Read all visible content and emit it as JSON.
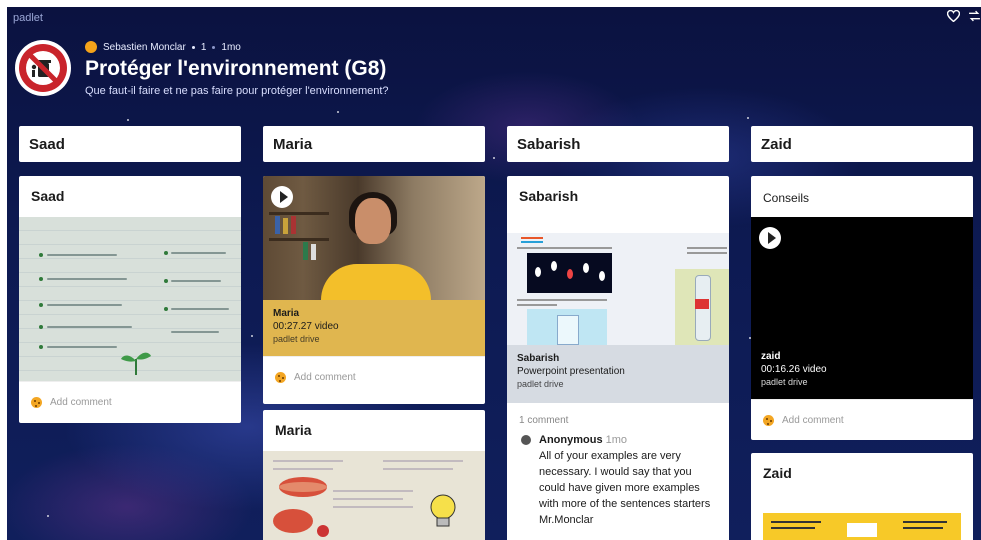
{
  "app": {
    "brand": "padlet"
  },
  "header": {
    "author": "Sebastien Monclar",
    "reactions": "1",
    "age": "1mo",
    "title": "Protéger l'environnement (G8)",
    "subtitle": "Que faut-il faire et ne pas faire pour protéger l'environnement?"
  },
  "icons": {
    "heart": "heart-icon",
    "remake": "remake-icon",
    "play": "play-icon",
    "cookie": "cookie-avatar-icon"
  },
  "colors": {
    "background": "#0d1a52",
    "author_dot": "#f5a31a",
    "video_bar": "#e0b64f",
    "attachment_bar": "#d6dbe2"
  },
  "columns": [
    {
      "name": "Saad",
      "cards": [
        {
          "title": "Saad",
          "comment_cta": "Add comment"
        }
      ]
    },
    {
      "name": "Maria",
      "cards": [
        {
          "name": "Maria",
          "duration": "00:27.27 video",
          "source": "padlet drive",
          "comment_cta": "Add comment"
        },
        {
          "title": "Maria"
        }
      ]
    },
    {
      "name": "Sabarish",
      "cards": [
        {
          "title": "Sabarish",
          "attachment_title": "Sabarish",
          "attachment_type": "Powerpoint presentation",
          "attachment_source": "padlet drive",
          "comments_count": "1 comment",
          "comment": {
            "author": "Anonymous",
            "time": "1mo",
            "text": "All of your examples are very necessary. I would say that you could have given more examples with more of the sentences starters Mr.Monclar"
          }
        }
      ]
    },
    {
      "name": "Zaid",
      "cards": [
        {
          "title": "Conseils",
          "name": "zaid",
          "duration": "00:16.26 video",
          "source": "padlet drive",
          "comment_cta": "Add comment"
        },
        {
          "title": "Zaid"
        }
      ]
    }
  ]
}
